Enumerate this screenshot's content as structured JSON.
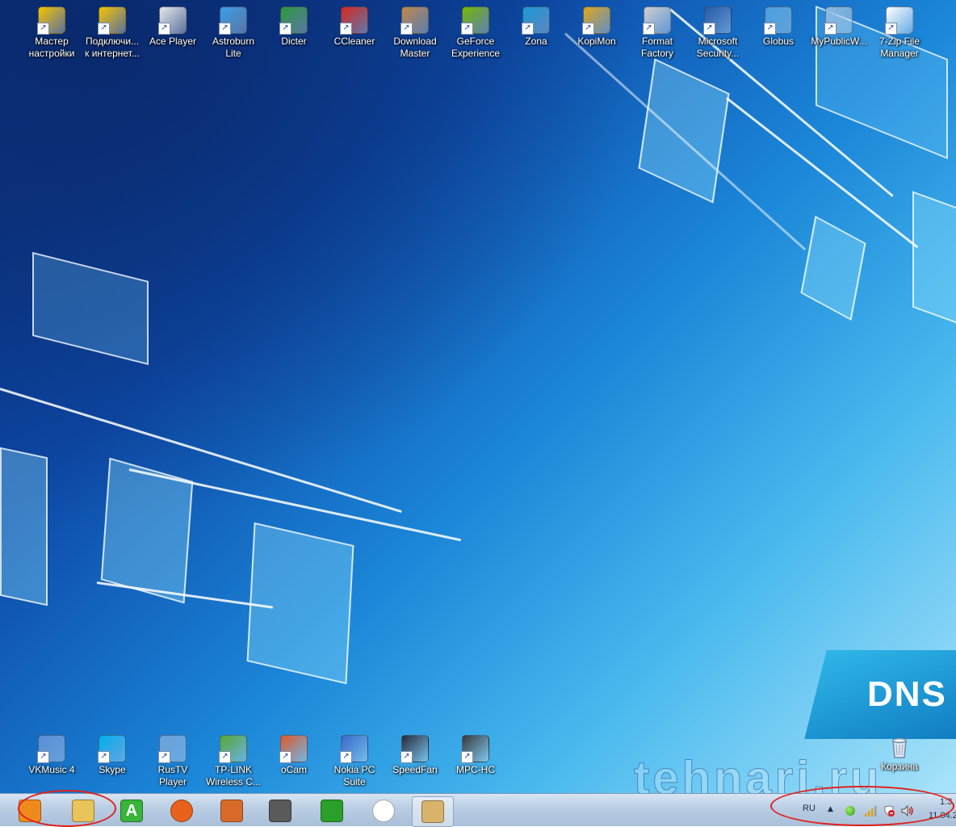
{
  "desktop": {
    "brand": "DNS",
    "watermark": "tehnari.ru",
    "top_icons": [
      {
        "label": "Мастер настройки",
        "icon": "beeline-wizard-icon",
        "color": "#f5c400"
      },
      {
        "label": "Подключи... к интернет...",
        "icon": "beeline-connect-icon",
        "color": "#f5c400"
      },
      {
        "label": "Ace Player",
        "icon": "ace-player-icon",
        "color": "#e8e8e8"
      },
      {
        "label": "Astroburn Lite",
        "icon": "astroburn-icon",
        "color": "#3aa0e8"
      },
      {
        "label": "Dicter",
        "icon": "dicter-icon",
        "color": "#2c9a3a"
      },
      {
        "label": "CCleaner",
        "icon": "ccleaner-icon",
        "color": "#d9281e"
      },
      {
        "label": "Download Master",
        "icon": "download-master-icon",
        "color": "#c08a4a"
      },
      {
        "label": "GeForce Experience",
        "icon": "geforce-icon",
        "color": "#76b900"
      },
      {
        "label": "Zona",
        "icon": "zona-icon",
        "color": "#1a9ad6"
      },
      {
        "label": "KopiMon",
        "icon": "kopimon-icon",
        "color": "#e0a81c"
      },
      {
        "label": "Format Factory",
        "icon": "format-factory-icon",
        "color": "#d0d0d0"
      },
      {
        "label": "Microsoft Security...",
        "icon": "microsoft-security-icon",
        "color": "#2a5aa8"
      },
      {
        "label": "Globus",
        "icon": "globus-icon",
        "color": "#4aa0e0"
      },
      {
        "label": "MyPublicW...",
        "icon": "mypublicwifi-icon",
        "color": "#8cb8e0"
      },
      {
        "label": "7-Zip File Manager",
        "icon": "7zip-icon",
        "color": "#ffffff"
      }
    ],
    "bottom_icons": [
      {
        "label": "VKMusic 4",
        "icon": "vkmusic-icon",
        "color": "#5b8fd6"
      },
      {
        "label": "Skype",
        "icon": "skype-icon",
        "color": "#00aff0"
      },
      {
        "label": "RusTV Player",
        "icon": "rustv-icon",
        "color": "#6ea0d8"
      },
      {
        "label": "TP-LINK Wireless C...",
        "icon": "tplink-icon",
        "color": "#5aa832"
      },
      {
        "label": "oCam",
        "icon": "ocam-icon",
        "color": "#e05a2a"
      },
      {
        "label": "Nokia PC Suite",
        "icon": "nokia-pc-suite-icon",
        "color": "#3a6ac8"
      },
      {
        "label": "SpeedFan",
        "icon": "speedfan-icon",
        "color": "#2a2a3a"
      },
      {
        "label": "MPC-HC",
        "icon": "mpc-hc-icon",
        "color": "#3a3a3a"
      }
    ],
    "recycle_bin": {
      "label": "Корзина",
      "icon": "recycle-bin-icon"
    }
  },
  "taskbar": {
    "buttons": [
      {
        "name": "windows-media-player-button",
        "icon": "media-player-icon",
        "color": "#f08a1c"
      },
      {
        "name": "explorer-button",
        "icon": "folder-icon",
        "color": "#e8c45a"
      },
      {
        "name": "app-a-button",
        "icon": "green-a-icon",
        "color": "#3ab43a",
        "glyph": "A"
      },
      {
        "name": "firefox-button",
        "icon": "firefox-icon",
        "color": "#e8621c"
      },
      {
        "name": "mfc-button",
        "icon": "mfc-blocks-icon",
        "color": "#d86a2a"
      },
      {
        "name": "tool-button",
        "icon": "valve-icon",
        "color": "#5a5a5a"
      },
      {
        "name": "green-valve-button",
        "icon": "green-valve-icon",
        "color": "#2aa02a"
      },
      {
        "name": "skull-button",
        "icon": "skull-icon",
        "color": "#ffffff"
      },
      {
        "name": "paint-button",
        "icon": "paint-palette-icon",
        "color": "#d8b46a"
      }
    ],
    "tray": {
      "language": "RU",
      "clock_time": "1:3",
      "clock_date": "11.04.2"
    }
  }
}
